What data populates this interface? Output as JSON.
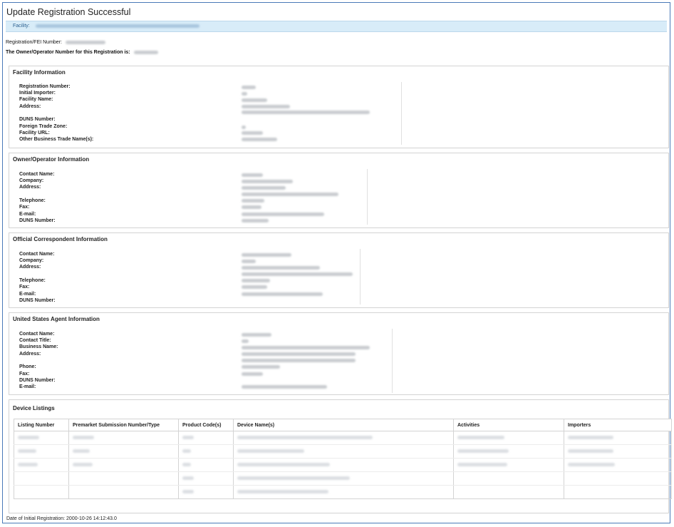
{
  "page": {
    "title": "Update Registration Successful",
    "facility_label": "Facility:",
    "fei_label": "Registration/FEI Number:",
    "owner_number_text": "The Owner/Operator Number for this Registration is:"
  },
  "sections": {
    "facility": {
      "title": "Facility Information",
      "labels": [
        "Registration Number:",
        "Initial Importer:",
        "Facility Name:",
        "Address:",
        "DUNS Number:",
        "Foreign Trade Zone:",
        "Facility URL:",
        "Other Business Trade Name(s):"
      ]
    },
    "owner": {
      "title": "Owner/Operator Information",
      "labels": [
        "Contact Name:",
        "Company:",
        "Address:",
        "Telephone:",
        "Fax:",
        "E-mail:",
        "DUNS Number:"
      ]
    },
    "correspondent": {
      "title": "Official Correspondent Information",
      "labels": [
        "Contact Name:",
        "Company:",
        "Address:",
        "Telephone:",
        "Fax:",
        "E-mail:",
        "DUNS Number:"
      ]
    },
    "agent": {
      "title": "United States Agent Information",
      "labels": [
        "Contact Name:",
        "Contact Title:",
        "Business Name:",
        "Address:",
        "Phone:",
        "Fax:",
        "DUNS Number:",
        "E-mail:"
      ]
    },
    "devices": {
      "title": "Device Listings",
      "columns": [
        "Listing Number",
        "Premarket Submission Number/Type",
        "Product Code(s)",
        "Device Name(s)",
        "Activities",
        "Importers"
      ]
    }
  },
  "footer": {
    "text": "Date of Initial Registration: 2000-10-26 14:12:43.0"
  },
  "colors": {
    "frame_border": "#4a7ab8",
    "facility_bar": "#d8ecf8",
    "redacted": "#c9ccd0"
  }
}
